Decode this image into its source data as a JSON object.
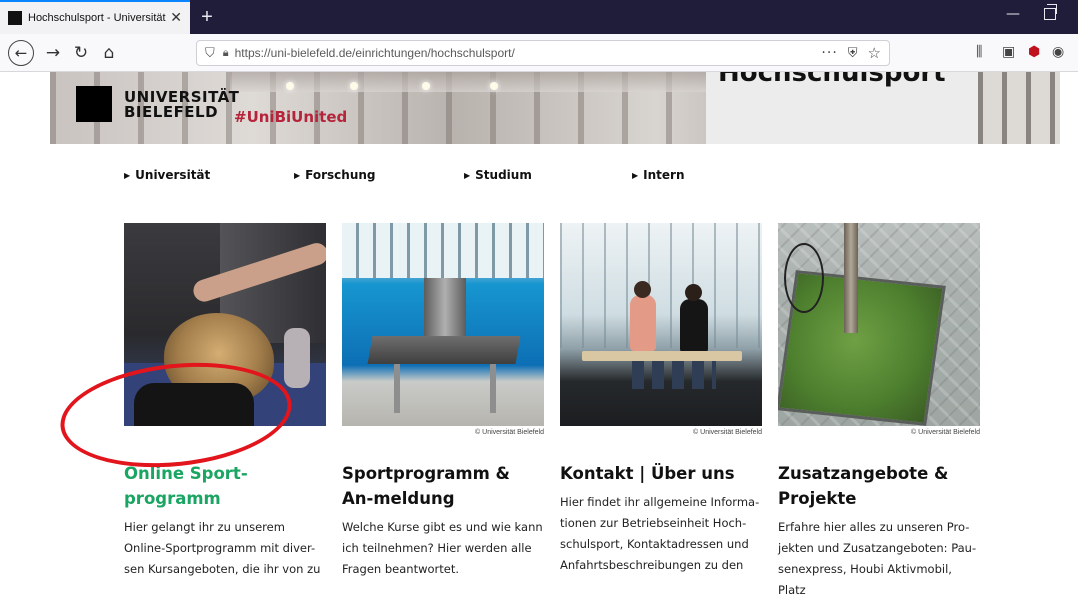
{
  "browser": {
    "tab_title": "Hochschulsport - Universität Bi",
    "tab_close": "✕",
    "new_tab": "+",
    "url": "https://uni-bielefeld.de/einrichtungen/hochschulsport/",
    "url_more": "···",
    "icons": [
      "back-icon",
      "forward-icon",
      "reload-icon",
      "home-icon",
      "shield-icon",
      "lock-icon",
      "pocket-icon",
      "star-icon",
      "library-icon",
      "sidebar-icon",
      "ublock-icon",
      "account-icon"
    ]
  },
  "hero": {
    "logo_line1": "UNIVERSITÄT",
    "logo_line2": "BIELEFELD",
    "hashtag": "#UniBiUnited",
    "page_title": "Hochschulsport"
  },
  "mainnav": {
    "items": [
      {
        "label": "Universität"
      },
      {
        "label": "Forschung"
      },
      {
        "label": "Studium"
      },
      {
        "label": "Intern"
      }
    ]
  },
  "cards": [
    {
      "credit": "",
      "title": "Online Sport-\nprogramm",
      "text": "Hier gelangt ihr zu unserem Online-Sportprogramm mit diver-sen Kursangeboten, die ihr von zu",
      "title_color": "#1aa563"
    },
    {
      "credit": "© Universität Bielefeld",
      "title": "Sportprogramm & An-meldung",
      "text": "Welche Kurse gibt es und wie kann ich teilnehmen? Hier werden alle Fragen beantwortet."
    },
    {
      "credit": "© Universität Bielefeld",
      "title": "Kontakt | Über uns",
      "text": "Hier findet ihr allgemeine Informa-tionen zur Betriebseinheit Hoch-schulsport, Kontaktadressen und Anfahrtsbeschreibungen zu den"
    },
    {
      "credit": "© Universität Bielefeld",
      "title": "Zusatzangebote & Projekte",
      "text": "Erfahre hier alles zu unseren Pro-jekten und Zusatzangeboten: Pau-senexpress, Houbi Aktivmobil, Platz"
    }
  ],
  "colors": {
    "accent_green": "#1aa563",
    "hashtag_red": "#b5243a",
    "annotation_red": "#e2141c"
  }
}
